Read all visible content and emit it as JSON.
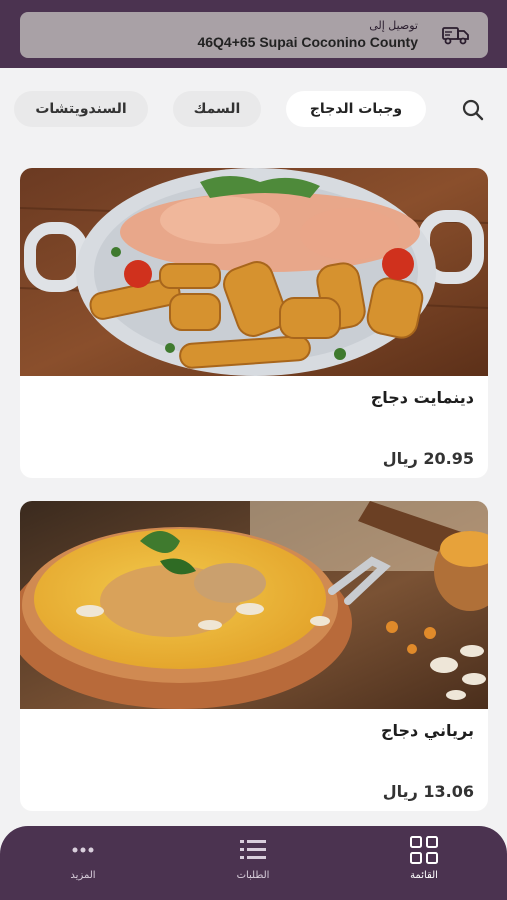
{
  "delivery": {
    "label": "توصيل إلى",
    "address": "46Q4+65 Supai Coconino County",
    "icon": "truck-icon"
  },
  "categories": {
    "search_icon": "search-icon",
    "items": [
      {
        "label": "وجبات الدجاج",
        "active": true
      },
      {
        "label": "السمك",
        "active": false
      },
      {
        "label": "السندويتشات",
        "active": false
      }
    ]
  },
  "products": [
    {
      "name": "دينمايت دجاج",
      "price": "20.95 ريال",
      "image": "dynamite-chicken-dish"
    },
    {
      "name": "برياني دجاج",
      "price": "13.06 ريال",
      "image": "chicken-biryani-dish"
    }
  ],
  "bottom_nav": {
    "items": [
      {
        "label": "القائمة",
        "icon": "grid-icon"
      },
      {
        "label": "الطلبات",
        "icon": "list-icon"
      },
      {
        "label": "المزيد",
        "icon": "more-icon"
      }
    ]
  },
  "colors": {
    "brand": "#4b3350",
    "accent_bg": "#a9a1a6",
    "chip_active": "#ffffff",
    "chip_inactive": "#e9e9ea"
  }
}
